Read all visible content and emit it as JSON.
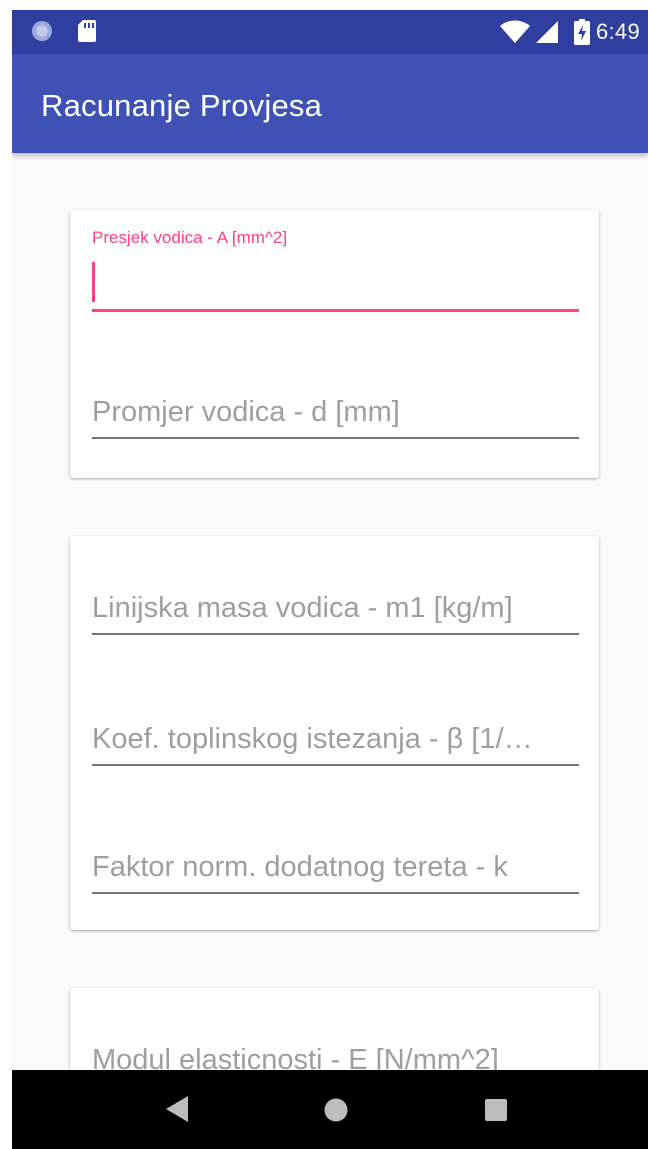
{
  "status_bar": {
    "time": "6:49",
    "icons": [
      "notification-circle-icon",
      "sd-card-icon",
      "wifi-icon",
      "signal-icon",
      "battery-charging-icon"
    ],
    "color": "#303f9f"
  },
  "app_bar": {
    "title": "Racunanje Provjesa",
    "color": "#3f51b5"
  },
  "accent_color": "#ff4081",
  "cards": [
    {
      "fields": [
        {
          "label": "Presjek vodica - A [mm^2]",
          "value": "",
          "focused": true
        },
        {
          "placeholder": "Promjer vodica - d [mm]",
          "value": ""
        }
      ]
    },
    {
      "fields": [
        {
          "placeholder": "Linijska masa vodica - m1 [kg/m]",
          "value": ""
        },
        {
          "placeholder": "Koef. toplinskog istezanja - β [1/…",
          "value": ""
        },
        {
          "placeholder": "Faktor norm. dodatnog tereta - k",
          "value": ""
        }
      ]
    },
    {
      "fields": [
        {
          "placeholder": "Modul elasticnosti - E [N/mm^2]",
          "value": ""
        }
      ]
    }
  ],
  "nav_bar": {
    "buttons": [
      "back-icon",
      "home-icon",
      "recents-icon"
    ]
  }
}
